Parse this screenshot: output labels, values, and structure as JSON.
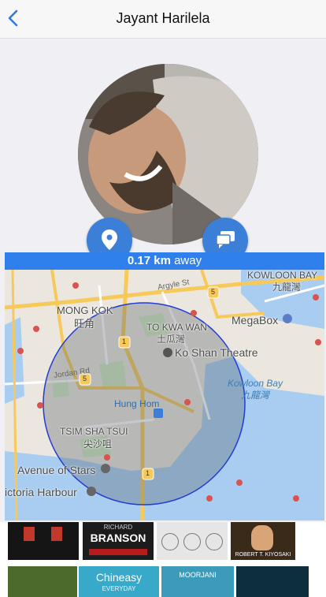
{
  "header": {
    "title": "Jayant Harilela"
  },
  "distance": {
    "value": "0.17 km",
    "suffix": " away"
  },
  "map": {
    "labels": {
      "mong_kok": "MONG KOK",
      "mong_kok_zh": "旺角",
      "to_kwa_wan": "TO KWA WAN",
      "to_kwa_wan_zh": "土瓜灣",
      "ko_shan": "Ko Shan Theatre",
      "kowloon_bay": "KOWLOON BAY",
      "kowloon_bay_zh": "九龍灣",
      "megabox": "MegaBox",
      "kowloon_bay_water": "Kowloon Bay",
      "kowloon_bay_water_zh": "九龍灣",
      "hung_hom": "Hung Hom",
      "tsim_sha_tsui": "TSIM SHA TSUI",
      "tsim_sha_tsui_zh": "尖沙咀",
      "avenue_of_stars": "Avenue of Stars",
      "victoria_harbour": "ictoria Harbour",
      "jordan_rd": "Jordan Rd",
      "argyle_st": "Argyle St",
      "route_1a": "1",
      "route_1b": "1",
      "route_5a": "5",
      "route_5b": "5"
    }
  },
  "books": {
    "branson_line1": "RICHARD",
    "branson_line2": "BRANSON",
    "kiyosaki": "ROBERT T. KIYOSAKI",
    "chineasy_title": "Chineasy",
    "chineasy_sub": "EVERYDAY",
    "moorjani": "MOORJANI"
  },
  "colors": {
    "accent": "#2f80ed",
    "button": "#3b7fd8",
    "radius": "#1f3bd6"
  }
}
